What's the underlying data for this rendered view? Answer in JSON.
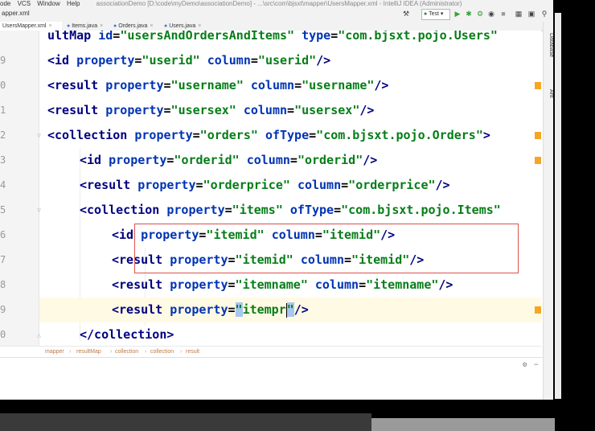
{
  "menu": {
    "items": [
      "ode",
      "VCS",
      "Window",
      "Help"
    ],
    "window_title": "associationDemo [D:\\code\\myDemo\\associationDemo] - ...\\src\\com\\bjsxt\\mapper\\UsersMapper.xml - IntelliJ IDEA (Administrator)"
  },
  "toolbar": {
    "path_label": "apper.xml",
    "run_config": "Test"
  },
  "tabs": [
    {
      "label": "UsersMapper.xml",
      "active": true
    },
    {
      "label": "Items.java",
      "active": false
    },
    {
      "label": "Orders.java",
      "active": false
    },
    {
      "label": "Users.java",
      "active": false
    }
  ],
  "editor": {
    "line_numbers": [
      "",
      "9",
      "0",
      "1",
      "2",
      "3",
      "4",
      "5",
      "6",
      "7",
      "8",
      "9",
      "0"
    ],
    "lines": [
      {
        "indent": 0,
        "tag": "ultMap",
        "attrs": [
          [
            "id",
            "usersAndOrdersAndItems"
          ],
          [
            "type",
            "com.bjsxt.pojo.Users"
          ]
        ],
        "close": "",
        "open_bracket": false
      },
      {
        "indent": 0,
        "tag": "<id",
        "attrs": [
          [
            "property",
            "userid"
          ],
          [
            "column",
            "userid"
          ]
        ],
        "close": "/>"
      },
      {
        "indent": 0,
        "tag": "<result",
        "attrs": [
          [
            "property",
            "username"
          ],
          [
            "column",
            "username"
          ]
        ],
        "close": "/>"
      },
      {
        "indent": 0,
        "tag": "<result",
        "attrs": [
          [
            "property",
            "usersex"
          ],
          [
            "column",
            "usersex"
          ]
        ],
        "close": "/>"
      },
      {
        "indent": 0,
        "tag": "<collection",
        "attrs": [
          [
            "property",
            "orders"
          ],
          [
            "ofType",
            "com.bjsxt.pojo.Orders"
          ]
        ],
        "close": ">"
      },
      {
        "indent": 1,
        "tag": "<id",
        "attrs": [
          [
            "property",
            "orderid"
          ],
          [
            "column",
            "orderid"
          ]
        ],
        "close": "/>"
      },
      {
        "indent": 1,
        "tag": "<result",
        "attrs": [
          [
            "property",
            "orderprice"
          ],
          [
            "column",
            "orderprice"
          ]
        ],
        "close": "/>"
      },
      {
        "indent": 1,
        "tag": "<collection",
        "attrs": [
          [
            "property",
            "items"
          ],
          [
            "ofType",
            "com.bjsxt.pojo.Items"
          ]
        ],
        "close": ""
      },
      {
        "indent": 2,
        "tag": "<id",
        "attrs": [
          [
            "property",
            "itemid"
          ],
          [
            "column",
            "itemid"
          ]
        ],
        "close": "/>"
      },
      {
        "indent": 2,
        "tag": "<result",
        "attrs": [
          [
            "property",
            "itemid"
          ],
          [
            "column",
            "itemid"
          ]
        ],
        "close": "/>"
      },
      {
        "indent": 2,
        "tag": "<result",
        "attrs": [
          [
            "property",
            "itemname"
          ],
          [
            "column",
            "itemname"
          ]
        ],
        "close": "/>"
      },
      {
        "indent": 2,
        "tag": "<result",
        "attrs": [
          [
            "property",
            "itempr"
          ]
        ],
        "close": "/>",
        "current": true
      },
      {
        "indent": 1,
        "tag": "</collection>",
        "attrs": [],
        "close": ""
      }
    ]
  },
  "side_panels": {
    "database": "Database",
    "ant": "Ant"
  },
  "breadcrumbs": [
    "mapper",
    "resultMap",
    "collection",
    "collection",
    "result"
  ],
  "colors": {
    "tag": "#000080",
    "attr_name": "#0033b3",
    "attr_value": "#067d17",
    "selection_border": "#d9534f",
    "current_line": "#fffae3",
    "breadcrumb": "#c07a45"
  }
}
